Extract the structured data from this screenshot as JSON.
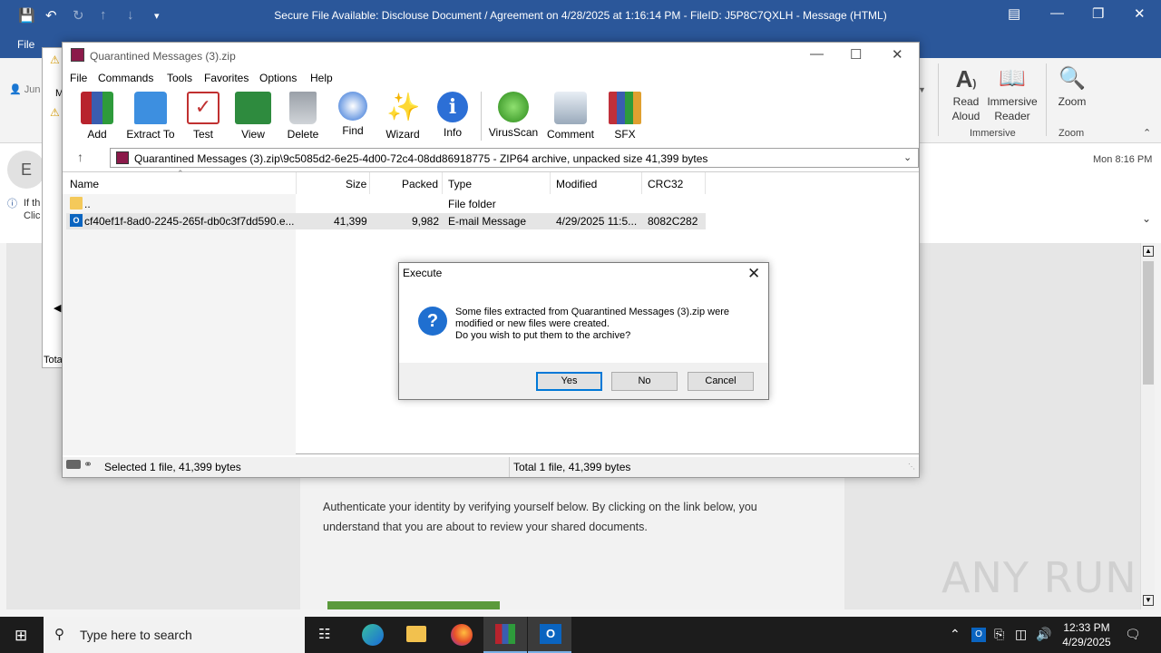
{
  "outlook": {
    "window_title": "Secure File Available: Disclouse Document / Agreement on 4/28/2025 at 1:16:14 PM - FileID: J5P8C7QXLH  -  Message (HTML)",
    "file_tab": "File",
    "ribbon": {
      "read_aloud": "Read Aloud",
      "immersive_reader": "Immersive Reader",
      "zoom": "Zoom",
      "group_immersive": "Immersive",
      "group_zoom": "Zoom"
    },
    "sender_initial": "E",
    "date": "Mon 8:16 PM",
    "body_text": "Authenticate your identity by verifying yourself below. By clicking on the link below, you understand that you are about to review your shared documents.",
    "partial_left": {
      "junk": "Jun",
      "info1": "If th",
      "info2": "Clic",
      "m": "M",
      "total": "Tota"
    }
  },
  "winrar": {
    "title": "Quarantined Messages (3).zip",
    "menu": [
      "File",
      "Commands",
      "Tools",
      "Favorites",
      "Options",
      "Help"
    ],
    "toolbar": [
      "Add",
      "Extract To",
      "Test",
      "View",
      "Delete",
      "Find",
      "Wizard",
      "Info",
      "VirusScan",
      "Comment",
      "SFX"
    ],
    "address": "Quarantined Messages (3).zip\\9c5085d2-6e25-4d00-72c4-08dd86918775 - ZIP64 archive, unpacked size 41,399 bytes",
    "columns": {
      "name": "Name",
      "size": "Size",
      "packed": "Packed",
      "type": "Type",
      "modified": "Modified",
      "crc": "CRC32"
    },
    "rows": [
      {
        "name": "..",
        "size": "",
        "packed": "",
        "type": "File folder",
        "modified": "",
        "crc": ""
      },
      {
        "name": "cf40ef1f-8ad0-2245-265f-db0c3f7dd590.e...",
        "size": "41,399",
        "packed": "9,982",
        "type": "E-mail Message",
        "modified": "4/29/2025 11:5...",
        "crc": "8082C282"
      }
    ],
    "status_left": "Selected 1 file, 41,399 bytes",
    "status_right": "Total 1 file, 41,399 bytes"
  },
  "dialog": {
    "title": "Execute",
    "message_line1": "Some files extracted from Quarantined Messages (3).zip were",
    "message_line2": "modified or new files were created.",
    "message_line3": "Do you wish to put them to the archive?",
    "yes": "Yes",
    "no": "No",
    "cancel": "Cancel"
  },
  "taskbar": {
    "search_placeholder": "Type here to search",
    "time": "12:33 PM",
    "date": "4/29/2025"
  },
  "watermark": "ANY RUN"
}
